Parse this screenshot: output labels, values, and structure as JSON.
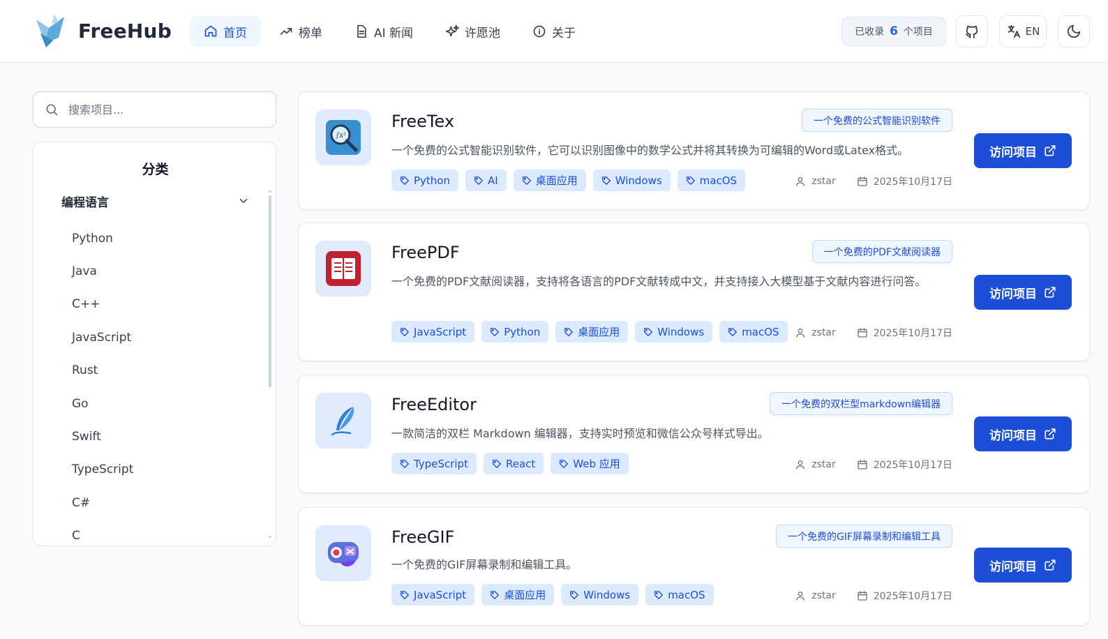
{
  "brand": {
    "name": "FreeHub"
  },
  "nav": [
    {
      "label": "首页",
      "icon": "home-icon",
      "active": true
    },
    {
      "label": "榜单",
      "icon": "trending-icon",
      "active": false
    },
    {
      "label": "AI 新闻",
      "icon": "document-icon",
      "active": false
    },
    {
      "label": "许愿池",
      "icon": "sparkles-icon",
      "active": false
    },
    {
      "label": "关于",
      "icon": "info-icon",
      "active": false
    }
  ],
  "header": {
    "count_prefix": "已收录",
    "count_value": "6",
    "count_suffix": "个项目",
    "lang_label": "EN"
  },
  "search": {
    "placeholder": "搜索项目..."
  },
  "categories": {
    "title": "分类",
    "group_label": "编程语言",
    "items": [
      "Python",
      "Java",
      "C++",
      "JavaScript",
      "Rust",
      "Go",
      "Swift",
      "TypeScript",
      "C#",
      "C"
    ]
  },
  "visit_label": "访问项目",
  "projects": [
    {
      "name": "FreeTex",
      "badge": "一个免费的公式智能识别软件",
      "description": "一个免费的公式智能识别软件，它可以识别图像中的数学公式并将其转换为可编辑的Word或Latex格式。",
      "tags": [
        "Python",
        "AI",
        "桌面应用",
        "Windows",
        "macOS"
      ],
      "author": "zstar",
      "date": "2025年10月17日"
    },
    {
      "name": "FreePDF",
      "badge": "一个免费的PDF文献阅读器",
      "description": "一个免费的PDF文献阅读器，支持将各语言的PDF文献转成中文，并支持接入大模型基于文献内容进行问答。",
      "tags": [
        "JavaScript",
        "Python",
        "桌面应用",
        "Windows",
        "macOS"
      ],
      "author": "zstar",
      "date": "2025年10月17日"
    },
    {
      "name": "FreeEditor",
      "badge": "一个免费的双栏型markdown编辑器",
      "description": "一款简洁的双栏 Markdown 编辑器，支持实时预览和微信公众号样式导出。",
      "tags": [
        "TypeScript",
        "React",
        "Web 应用"
      ],
      "author": "zstar",
      "date": "2025年10月17日"
    },
    {
      "name": "FreeGIF",
      "badge": "一个免费的GIF屏幕录制和编辑工具",
      "description": "一个免费的GIF屏幕录制和编辑工具。",
      "tags": [
        "JavaScript",
        "桌面应用",
        "Windows",
        "macOS"
      ],
      "author": "zstar",
      "date": "2025年10月17日"
    }
  ],
  "colors": {
    "accent": "#1d4ed8",
    "tag_bg": "#dbeafe",
    "nav_active_bg": "#eff6ff"
  }
}
